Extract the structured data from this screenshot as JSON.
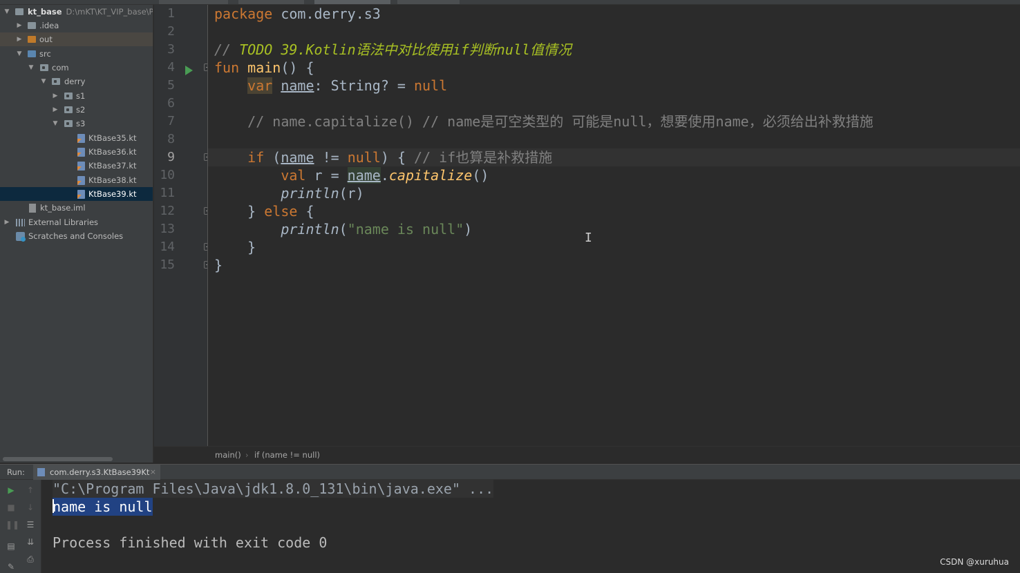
{
  "project_tree": {
    "root_name": "kt_base",
    "root_path": "D:\\mKT\\KT_VIP_base\\Pr",
    "items": [
      {
        "label": ".idea"
      },
      {
        "label": "out"
      },
      {
        "label": "src"
      },
      {
        "label": "com"
      },
      {
        "label": "derry"
      },
      {
        "label": "s1"
      },
      {
        "label": "s2"
      },
      {
        "label": "s3"
      },
      {
        "label": "KtBase35.kt"
      },
      {
        "label": "KtBase36.kt"
      },
      {
        "label": "KtBase37.kt"
      },
      {
        "label": "KtBase38.kt"
      },
      {
        "label": "KtBase39.kt"
      },
      {
        "label": "kt_base.iml"
      },
      {
        "label": "External Libraries"
      },
      {
        "label": "Scratches and Consoles"
      }
    ]
  },
  "editor": {
    "line_numbers": [
      "1",
      "2",
      "3",
      "4",
      "5",
      "6",
      "7",
      "8",
      "9",
      "10",
      "11",
      "12",
      "13",
      "14",
      "15"
    ],
    "current_line": "9",
    "code": {
      "l1_kw": "package",
      "l1_rest": " com.derry.s3",
      "l3_slashes": "// ",
      "l3_todo": "TODO 39.Kotlin语法中对比使用if判断null值情况",
      "l4_kw": "fun",
      "l4_fn": "main",
      "l4_rest": "() {",
      "l5_kw": "var",
      "l5_name": "name",
      "l5_rest": ": String? = ",
      "l5_null": "null",
      "l7_comment": "// name.capitalize() // name是可空类型的 可能是null，想要使用name，必须给出补救措施",
      "l9_if": "if",
      "l9_open": " (",
      "l9_name": "name",
      "l9_neq": " != ",
      "l9_null": "null",
      "l9_close": ") { ",
      "l9_comment": "// if也算是补救措施",
      "l10_val": "val",
      "l10_r": " r = ",
      "l10_name": "name",
      "l10_dot": ".",
      "l10_fn": "capitalize",
      "l10_paren": "()",
      "l11_fn": "println",
      "l11_args": "(r)",
      "l12_close": "} ",
      "l12_else": "else",
      "l12_open": " {",
      "l13_fn": "println",
      "l13_open": "(",
      "l13_str": "\"name is null\"",
      "l13_close": ")",
      "l14_close": "}",
      "l15_close": "}"
    },
    "cursor_glyph": "I"
  },
  "breadcrumb": {
    "first": "main()",
    "separator": "›",
    "second": "if (name != null)"
  },
  "run_panel": {
    "label": "Run:",
    "tab_title": "com.derry.s3.KtBase39Kt",
    "tab_close": "×",
    "console_lines": {
      "command": "\"C:\\Program Files\\Java\\jdk1.8.0_131\\bin\\java.exe\" ...",
      "output": "name is null",
      "finished": "Process finished with exit code 0"
    }
  },
  "watermark": "CSDN @xuruhua",
  "colors": {
    "keyword": "#cc7832",
    "function": "#ffc66d",
    "string": "#6a8759",
    "comment": "#808080",
    "todo": "#a8c023",
    "selection": "#214283"
  }
}
